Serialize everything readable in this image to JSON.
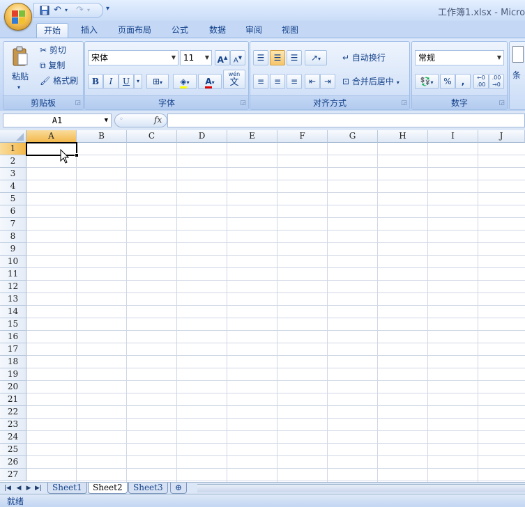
{
  "window": {
    "title": "工作簿1.xlsx - Micro"
  },
  "tabs": [
    "开始",
    "插入",
    "页面布局",
    "公式",
    "数据",
    "审阅",
    "视图"
  ],
  "ribbon": {
    "clipboard": {
      "label": "剪贴板",
      "paste": "粘贴",
      "cut": "剪切",
      "copy": "复制",
      "format_painter": "格式刷"
    },
    "font": {
      "label": "字体",
      "font_name": "宋体",
      "font_size": "11",
      "bold": "B",
      "italic": "I",
      "underline": "U",
      "grow": "A",
      "shrink": "A",
      "wen": "wén",
      "wen_char": "文"
    },
    "alignment": {
      "label": "对齐方式",
      "wrap_text": "自动换行",
      "merge_center": "合并后居中"
    },
    "number": {
      "label": "数字",
      "format": "常规",
      "percent": "%",
      "comma": ",",
      "inc_decimal": ".00",
      "dec_decimal": ".00"
    },
    "styles": {
      "partial_label": "条"
    }
  },
  "formula_bar": {
    "name_box": "A1",
    "fx": "fx"
  },
  "grid": {
    "columns": [
      "A",
      "B",
      "C",
      "D",
      "E",
      "F",
      "G",
      "H",
      "I",
      "J"
    ],
    "rows": [
      "1",
      "2",
      "3",
      "4",
      "5",
      "6",
      "7",
      "8",
      "9",
      "10",
      "11",
      "12",
      "13",
      "14",
      "15",
      "16",
      "17",
      "18",
      "19",
      "20",
      "21",
      "22",
      "23",
      "24",
      "25",
      "26",
      "27"
    ],
    "active_cell": "A1"
  },
  "sheets": [
    "Sheet1",
    "Sheet2",
    "Sheet3"
  ],
  "status": {
    "text": "就绪"
  }
}
